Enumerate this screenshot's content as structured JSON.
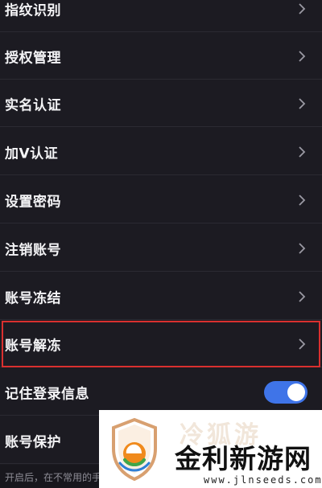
{
  "settings": {
    "items": [
      {
        "label": "指纹识别",
        "type": "link"
      },
      {
        "label": "授权管理",
        "type": "link"
      },
      {
        "label": "实名认证",
        "type": "link"
      },
      {
        "label": "加V认证",
        "type": "link"
      },
      {
        "label": "设置密码",
        "type": "link"
      },
      {
        "label": "注销账号",
        "type": "link"
      },
      {
        "label": "账号冻结",
        "type": "link"
      },
      {
        "label": "账号解冻",
        "type": "link",
        "highlighted": true
      },
      {
        "label": "记住登录信息",
        "type": "toggle",
        "toggle_on": true
      },
      {
        "label": "账号保护",
        "type": "toggle"
      }
    ],
    "footer_note": "开启后，在不常用的手"
  },
  "watermark": {
    "faded_text": "冷狐游",
    "title": "金利新游网",
    "url": "www.jlnseeds.com",
    "logo_icon": "shield-e-logo-icon"
  },
  "colors": {
    "background": "#1c1b22",
    "highlight_border": "#d9302f",
    "toggle_on": "#3f74e8"
  }
}
